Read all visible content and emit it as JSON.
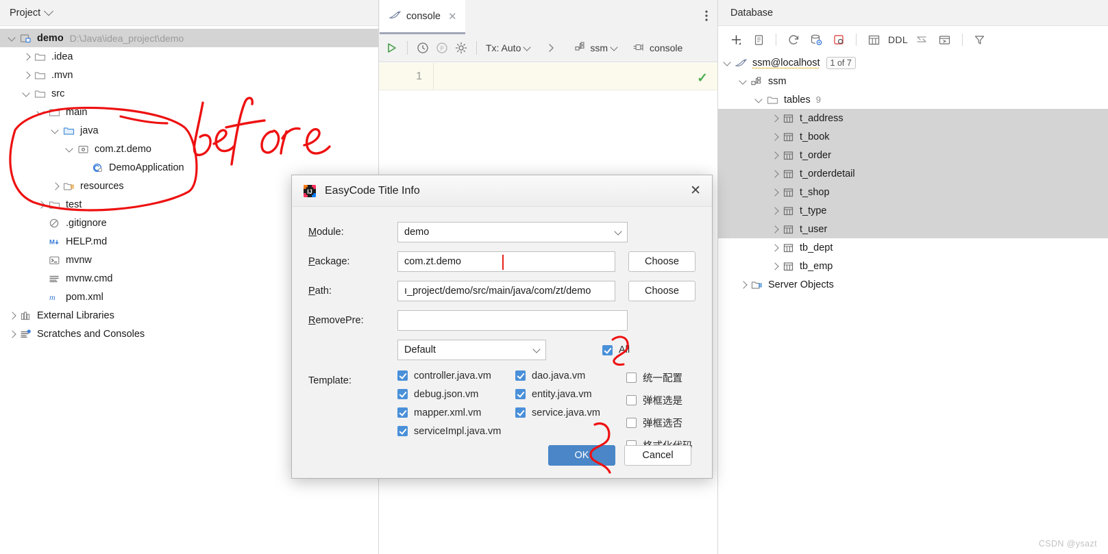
{
  "project_panel": {
    "header": {
      "title": "Project",
      "chevron_icon": "chevron-down-icon"
    },
    "tree": [
      {
        "label": "demo",
        "sub": "D:\\Java\\idea_project\\demo",
        "indent": 0,
        "arrow": "down",
        "icon": "module-icon",
        "bold": true,
        "selected": true
      },
      {
        "label": ".idea",
        "sub": "",
        "indent": 1,
        "arrow": "right",
        "icon": "folder-icon",
        "bold": false,
        "selected": false
      },
      {
        "label": ".mvn",
        "sub": "",
        "indent": 1,
        "arrow": "right",
        "icon": "folder-icon",
        "bold": false,
        "selected": false
      },
      {
        "label": "src",
        "sub": "",
        "indent": 1,
        "arrow": "down",
        "icon": "folder-icon",
        "bold": false,
        "selected": false
      },
      {
        "label": "main",
        "sub": "",
        "indent": 2,
        "arrow": "down",
        "icon": "folder-icon",
        "bold": false,
        "selected": false
      },
      {
        "label": "java",
        "sub": "",
        "indent": 3,
        "arrow": "down",
        "icon": "source-folder-icon",
        "bold": false,
        "selected": false
      },
      {
        "label": "com.zt.demo",
        "sub": "",
        "indent": 4,
        "arrow": "down",
        "icon": "package-icon",
        "bold": false,
        "selected": false
      },
      {
        "label": "DemoApplication",
        "sub": "",
        "indent": 5,
        "arrow": "none",
        "icon": "java-class-icon",
        "bold": false,
        "selected": false
      },
      {
        "label": "resources",
        "sub": "",
        "indent": 3,
        "arrow": "right",
        "icon": "resources-folder-icon",
        "bold": false,
        "selected": false
      },
      {
        "label": "test",
        "sub": "",
        "indent": 2,
        "arrow": "right",
        "icon": "folder-icon",
        "bold": false,
        "selected": false
      },
      {
        "label": ".gitignore",
        "sub": "",
        "indent": 2,
        "arrow": "none",
        "icon": "gitignore-icon",
        "bold": false,
        "selected": false
      },
      {
        "label": "HELP.md",
        "sub": "",
        "indent": 2,
        "arrow": "none",
        "icon": "markdown-icon",
        "bold": false,
        "selected": false
      },
      {
        "label": "mvnw",
        "sub": "",
        "indent": 2,
        "arrow": "none",
        "icon": "shell-script-icon",
        "bold": false,
        "selected": false
      },
      {
        "label": "mvnw.cmd",
        "sub": "",
        "indent": 2,
        "arrow": "none",
        "icon": "text-file-icon",
        "bold": false,
        "selected": false
      },
      {
        "label": "pom.xml",
        "sub": "",
        "indent": 2,
        "arrow": "none",
        "icon": "maven-icon",
        "bold": false,
        "selected": false
      },
      {
        "label": "External Libraries",
        "sub": "",
        "indent": 0,
        "arrow": "right",
        "icon": "library-icon",
        "bold": false,
        "selected": false
      },
      {
        "label": "Scratches and Consoles",
        "sub": "",
        "indent": 0,
        "arrow": "right",
        "icon": "scratches-icon",
        "bold": false,
        "selected": false
      }
    ],
    "annotation": {
      "text": "before",
      "color": "#ee1111"
    }
  },
  "console_panel": {
    "tab": {
      "label": "console",
      "icon": "mysql-dolphin-icon",
      "close_icon": "close-icon"
    },
    "tab_options_icon": "more-options-icon",
    "toolbar": {
      "run_icon": "run-play-icon",
      "history_icon": "clock-history-icon",
      "pending_icon": "p-circle-icon",
      "settings_icon": "gear-icon",
      "tx_label": "Tx: Auto",
      "expand_icon": "chevron-right-icon",
      "schema_label": "ssm",
      "schema_icon": "schema-icon",
      "session_label": "console",
      "session_icon": "plug-connector-icon"
    },
    "editor": {
      "line_number": "1",
      "code": "",
      "status_icon": "check-ok-icon"
    }
  },
  "database_panel": {
    "header": {
      "title": "Database"
    },
    "toolbar_icons": [
      "add-plus-icon",
      "copy-icon",
      "refresh-sync-icon",
      "database-settings-icon",
      "new-query-console-icon",
      "table-grid-icon",
      "ddl-label",
      "jump-to-icon",
      "open-console-icon",
      "filter-funnel-icon"
    ],
    "ddl_label": "DDL",
    "tree": [
      {
        "label": "ssm@localhost",
        "indent": 0,
        "arrow": "down",
        "icon": "mysql-dolphin-icon",
        "badge": "1 of 7",
        "count": "",
        "selected": false,
        "underline": true
      },
      {
        "label": "ssm",
        "indent": 1,
        "arrow": "down",
        "icon": "schema-icon",
        "badge": "",
        "count": "",
        "selected": false,
        "underline": false
      },
      {
        "label": "tables",
        "indent": 2,
        "arrow": "down",
        "icon": "folder-icon",
        "badge": "",
        "count": "9",
        "selected": false,
        "underline": false
      },
      {
        "label": "t_address",
        "indent": 3,
        "arrow": "right",
        "icon": "table-icon",
        "badge": "",
        "count": "",
        "selected": true,
        "underline": false
      },
      {
        "label": "t_book",
        "indent": 3,
        "arrow": "right",
        "icon": "table-icon",
        "badge": "",
        "count": "",
        "selected": true,
        "underline": false
      },
      {
        "label": "t_order",
        "indent": 3,
        "arrow": "right",
        "icon": "table-icon",
        "badge": "",
        "count": "",
        "selected": true,
        "underline": false
      },
      {
        "label": "t_orderdetail",
        "indent": 3,
        "arrow": "right",
        "icon": "table-icon",
        "badge": "",
        "count": "",
        "selected": true,
        "underline": false
      },
      {
        "label": "t_shop",
        "indent": 3,
        "arrow": "right",
        "icon": "table-icon",
        "badge": "",
        "count": "",
        "selected": true,
        "underline": false
      },
      {
        "label": "t_type",
        "indent": 3,
        "arrow": "right",
        "icon": "table-icon",
        "badge": "",
        "count": "",
        "selected": true,
        "underline": false
      },
      {
        "label": "t_user",
        "indent": 3,
        "arrow": "right",
        "icon": "table-icon",
        "badge": "",
        "count": "",
        "selected": true,
        "underline": false
      },
      {
        "label": "tb_dept",
        "indent": 3,
        "arrow": "right",
        "icon": "table-icon",
        "badge": "",
        "count": "",
        "selected": false,
        "underline": false
      },
      {
        "label": "tb_emp",
        "indent": 3,
        "arrow": "right",
        "icon": "table-icon",
        "badge": "",
        "count": "",
        "selected": false,
        "underline": false
      },
      {
        "label": "Server Objects",
        "indent": 1,
        "arrow": "right",
        "icon": "server-objects-icon",
        "badge": "",
        "count": "",
        "selected": false,
        "underline": false
      }
    ]
  },
  "dialog": {
    "title": "EasyCode Title Info",
    "app_icon": "intellij-idea-icon",
    "close_icon": "close-icon",
    "fields": {
      "module_label": "Module:",
      "module_mnemonic": "M",
      "module_value": "demo",
      "package_label": "Package:",
      "package_mnemonic": "P",
      "package_value": "com.zt.demo",
      "path_label": "Path:",
      "path_mnemonic": "P",
      "path_value": "ı_project/demo/src/main/java/com/zt/demo",
      "removepre_label": "RemovePre:",
      "removepre_mnemonic": "R",
      "removepre_value": "",
      "template_label": "Template:",
      "template_preset": "Default"
    },
    "choose_button_1": "Choose",
    "choose_button_2": "Choose",
    "all_checkbox": {
      "label": "All",
      "checked": true
    },
    "templates": [
      {
        "label": "controller.java.vm",
        "checked": true
      },
      {
        "label": "dao.java.vm",
        "checked": true
      },
      {
        "label": "debug.json.vm",
        "checked": true
      },
      {
        "label": "entity.java.vm",
        "checked": true
      },
      {
        "label": "mapper.xml.vm",
        "checked": true
      },
      {
        "label": "service.java.vm",
        "checked": true
      },
      {
        "label": "serviceImpl.java.vm",
        "checked": true
      }
    ],
    "options": [
      {
        "label": "统一配置",
        "checked": false
      },
      {
        "label": "弹框选是",
        "checked": false
      },
      {
        "label": "弹框选否",
        "checked": false
      },
      {
        "label": "格式化代码",
        "checked": false
      }
    ],
    "ok_button": "OK",
    "cancel_button": "Cancel",
    "accent_color": "#4a86c8"
  },
  "watermark": "CSDN @ysazt"
}
